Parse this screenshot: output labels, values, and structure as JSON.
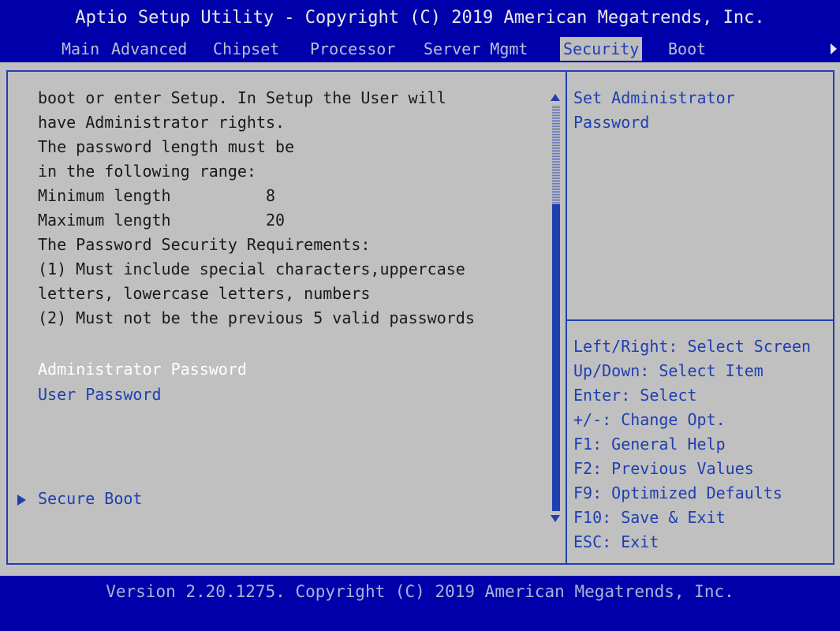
{
  "header": {
    "title": "Aptio Setup Utility - Copyright (C) 2019 American Megatrends, Inc.",
    "tabs": [
      {
        "label": "Main"
      },
      {
        "label": "Advanced"
      },
      {
        "label": "Chipset"
      },
      {
        "label": "Processor"
      },
      {
        "label": "Server Mgmt"
      },
      {
        "label": "Security"
      },
      {
        "label": "Boot"
      }
    ],
    "active_tab": "Security"
  },
  "left_pane": {
    "description_lines": [
      "boot or enter Setup. In Setup the User will",
      "have Administrator rights.",
      "The password length must be",
      "in the following range:",
      "Minimum length          8",
      "Maximum length          20",
      "The Password Security Requirements:",
      "(1) Must include special characters,uppercase",
      "letters, lowercase letters, numbers",
      "(2) Must not be the previous 5 valid passwords"
    ],
    "items": [
      {
        "label": "Administrator Password",
        "selected": true
      },
      {
        "label": "User Password",
        "selected": false
      }
    ],
    "submenu": {
      "label": "Secure Boot"
    }
  },
  "right_pane": {
    "help_lines": [
      "Set Administrator",
      "Password"
    ],
    "key_help": [
      "Left/Right: Select Screen",
      "Up/Down: Select Item",
      "Enter: Select",
      "+/-: Change Opt.",
      "F1: General Help",
      "F2: Previous Values",
      "F9: Optimized Defaults",
      "F10: Save & Exit",
      "ESC: Exit"
    ]
  },
  "footer": {
    "text": "Version 2.20.1275. Copyright (C) 2019 American Megatrends, Inc."
  },
  "colors": {
    "background": "#0000aa",
    "panel": "#c0c0c0",
    "accent": "#1f3fb0",
    "selected_text": "#ffffff"
  }
}
